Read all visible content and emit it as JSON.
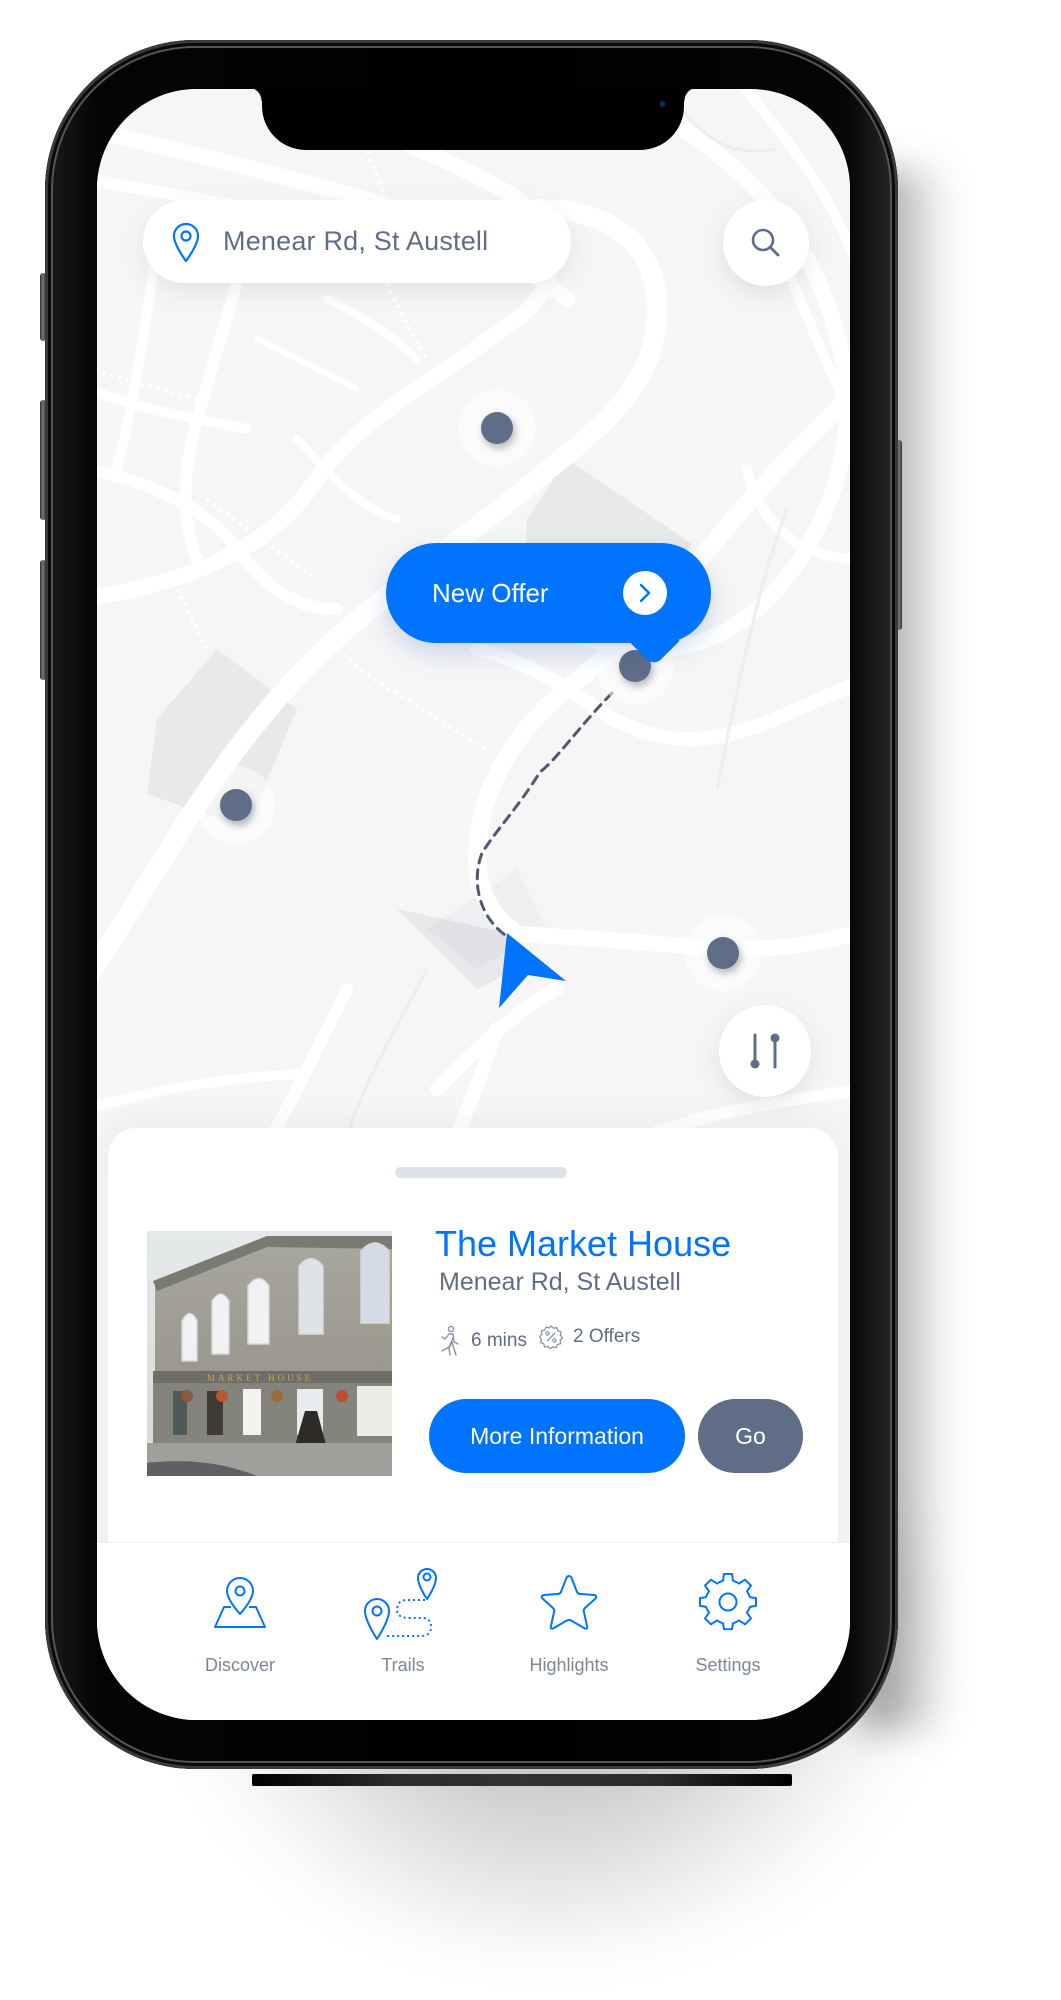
{
  "search": {
    "location_text": "Menear Rd, St Austell",
    "location_icon": "map-pin-icon",
    "search_icon": "search-icon"
  },
  "map": {
    "markers": [
      {
        "id": "marker-1"
      },
      {
        "id": "marker-offer"
      },
      {
        "id": "marker-3"
      },
      {
        "id": "marker-4"
      }
    ],
    "offer_bubble": {
      "label": "New Offer",
      "icon": "chevron-right-icon"
    },
    "current_location_icon": "navigation-arrow-icon",
    "filter_icon": "filter-sliders-icon"
  },
  "place_card": {
    "title": "The Market House",
    "address": "Menear Rd, St Austell",
    "photo_alt": "The Market House building",
    "photo_sign": "MARKET HOUSE",
    "walk_time": "6 mins",
    "walk_icon": "walking-person-icon",
    "offers": "2 Offers",
    "offers_icon": "discount-badge-icon",
    "more_info_label": "More Information",
    "go_label": "Go"
  },
  "tabbar": {
    "items": [
      {
        "label": "Discover",
        "icon": "map-location-icon"
      },
      {
        "label": "Trails",
        "icon": "route-pins-icon"
      },
      {
        "label": "Highlights",
        "icon": "star-icon"
      },
      {
        "label": "Settings",
        "icon": "gear-icon"
      }
    ]
  },
  "colors": {
    "accent": "#0074ff",
    "slate": "#5f6e86",
    "map_bg": "#f6f6f6",
    "road": "#ffffff"
  }
}
